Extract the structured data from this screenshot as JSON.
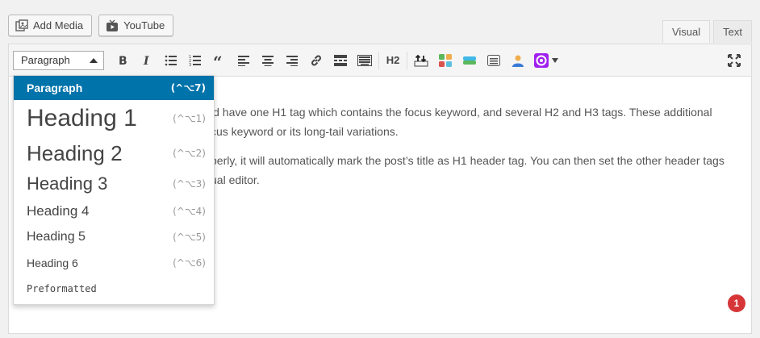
{
  "media_buttons": {
    "add_media": "Add Media",
    "youtube": "YouTube"
  },
  "tabs": {
    "visual": "Visual",
    "text": "Text"
  },
  "toolbar": {
    "format_select": "Paragraph",
    "h2": "H2"
  },
  "content": {
    "line1": "ld have one H1 tag which contains the focus keyword, and several H2 and H3 tags. These additional",
    "line2": "cus keyword or its long-tail variations.",
    "line3": "perly, it will automatically mark the post’s title as H1 header tag. You can then set the other header tags",
    "line4": "ual editor."
  },
  "format_menu": {
    "items": [
      {
        "label": "Paragraph",
        "shortcut": "(^⌥7)"
      },
      {
        "label": "Heading 1",
        "shortcut": "(^⌥1)"
      },
      {
        "label": "Heading 2",
        "shortcut": "(^⌥2)"
      },
      {
        "label": "Heading 3",
        "shortcut": "(^⌥3)"
      },
      {
        "label": "Heading 4",
        "shortcut": "(^⌥4)"
      },
      {
        "label": "Heading 5",
        "shortcut": "(^⌥5)"
      },
      {
        "label": "Heading 6",
        "shortcut": "(^⌥6)"
      },
      {
        "label": "Preformatted",
        "shortcut": ""
      }
    ]
  },
  "notification": {
    "count": "1"
  },
  "colors": {
    "accent": "#0073aa",
    "badge": "#d63638"
  }
}
